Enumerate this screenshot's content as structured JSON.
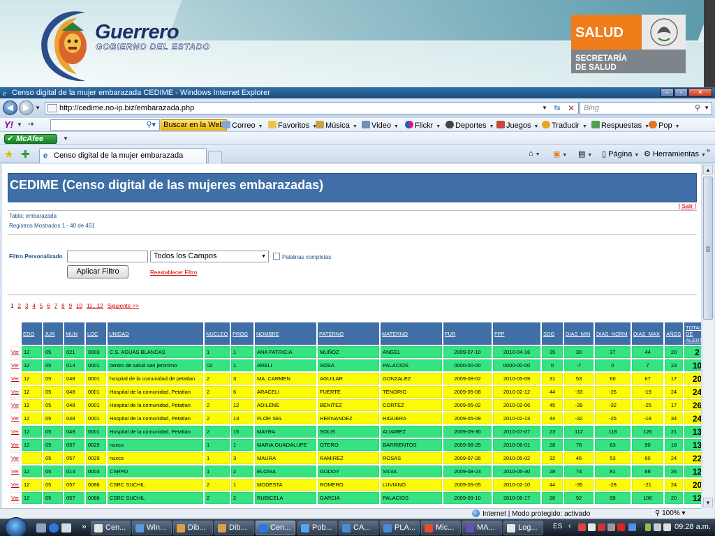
{
  "banner": {
    "brand": "Guerrero",
    "brand_sub": "GOBIERNO DEL ESTADO",
    "salud": "SALUD",
    "secretaria_line1": "SECRETARÍA",
    "secretaria_line2": "DE SALUD"
  },
  "window": {
    "title": "Censo digital de la mujer embarazada CEDIME - Windows Internet Explorer",
    "url": "http://cedime.no-ip.biz/embarazada.php",
    "search_placeholder": "Bing"
  },
  "yahoo_toolbar": {
    "search_button": "Buscar en la Web",
    "items": [
      "Correo",
      "Favoritos",
      "Música",
      "Video",
      "Flickr",
      "Deportes",
      "Juegos",
      "Traducir",
      "Respuestas",
      "Pop"
    ]
  },
  "mcafee": {
    "label": "McAfee"
  },
  "tab": {
    "label": "Censo digital de la mujer embarazada CEDIME"
  },
  "command_bar": {
    "pagina": "Página",
    "herramientas": "Herramientas"
  },
  "page": {
    "title": "CEDIME (Censo digital de las mujeres embarazadas)",
    "logout": "[ Salir ]",
    "tabla": "Tabla: embarazada",
    "registros": "Registros Mostrados 1 - 40 de 451",
    "filter_label": "Filtro Personalizado",
    "filter_value": "",
    "filter_select": "Todos los Campos",
    "words_label": "Palabras completas",
    "apply_button": "Aplicar Filtro",
    "reset_link": "Reestablecer Filtro"
  },
  "pager": [
    "1",
    "2",
    "3",
    "4",
    "5",
    "6",
    "7",
    "8",
    "9",
    "10",
    "11...12",
    "Siguiente >>"
  ],
  "table": {
    "headers": [
      "",
      "EDO",
      "JUR",
      "MUN",
      "LOC",
      "UNIDAD",
      "NUCLEO",
      "PROG",
      "NOMBRE",
      "PATERNO",
      "MATERNO",
      "FUR",
      "FPP",
      "SDG",
      "DIAS_MIN",
      "DIAS_NORM",
      "DIAS_MAX",
      "AÑOS",
      "TOTAL DE ALERTA"
    ],
    "link_label": "Ver",
    "rows": [
      {
        "color": "green",
        "cells": [
          "12",
          "05",
          "021",
          "0003",
          "C.S. AGUAS BLANCAS",
          "1",
          "1",
          "ANA PATRICIA",
          "MUÑOZ",
          "ANGEL",
          "2009-07-10",
          "2010-04-16",
          "35",
          "30",
          "37",
          "44",
          "20",
          "2"
        ]
      },
      {
        "color": "green",
        "cells": [
          "12",
          "05",
          "014",
          "0001",
          "centro de salud san jeronimo",
          "02",
          "1",
          "ARELI",
          "SOSA",
          "PALACIOS",
          "0000-00-00",
          "0000-00-00",
          "0",
          "-7",
          "0",
          "7",
          "23",
          "10"
        ]
      },
      {
        "color": "yellow",
        "cells": [
          "12",
          "05",
          "048",
          "0001",
          "hospital de la comunidad de petatlan",
          "2",
          "3",
          "MA. CARMEN",
          "AGUILAR",
          "GONZALEZ",
          "2009-08-02",
          "2010-05-09",
          "31",
          "53",
          "60",
          "67",
          "17",
          "20"
        ]
      },
      {
        "color": "yellow",
        "cells": [
          "12",
          "05",
          "048",
          "0001",
          "Hospital de la comunidad, Petatlan",
          "2",
          "6",
          "ARACELI",
          "FUERTE",
          "TENORIO",
          "2009-05-08",
          "2010-02-12",
          "44",
          "-33",
          "-26",
          "-19",
          "24",
          "24"
        ]
      },
      {
        "color": "yellow",
        "cells": [
          "12",
          "05",
          "048",
          "0001",
          "Hospital de la comunidad, Petatlan",
          "2",
          "12",
          "ADILENE",
          "BENITEZ",
          "CORTEZ",
          "2009-05-02",
          "2010-02-06",
          "45",
          "-39",
          "-32",
          "-25",
          "17",
          "26"
        ]
      },
      {
        "color": "yellow",
        "cells": [
          "12",
          "05",
          "048",
          "0001",
          "Hospital de la comunidad, Petatlan",
          "2",
          "13",
          "FLOR SEL",
          "HERNANDEZ",
          "HIGUERA",
          "2009-05-09",
          "2010-02-13",
          "44",
          "-32",
          "-25",
          "-18",
          "34",
          "24"
        ]
      },
      {
        "color": "green",
        "cells": [
          "12",
          "05",
          "048",
          "0001",
          "Hospital de la comunidad, Petatlan",
          "2",
          "15",
          "MAYRA",
          "SOLIS",
          "ALVAREZ",
          "2009-09-30",
          "2010-07-07",
          "23",
          "112",
          "118",
          "126",
          "21",
          "13"
        ]
      },
      {
        "color": "green",
        "cells": [
          "12",
          "05",
          "057",
          "0029",
          "nuxco",
          "1",
          "1",
          "MARIA GUADALUPE",
          "OTERO",
          "BARRIENTOS",
          "2009-08-25",
          "2010-06-01",
          "28",
          "76",
          "83",
          "90",
          "18",
          "13"
        ]
      },
      {
        "color": "yellow",
        "cells": [
          "",
          "05",
          "057",
          "0029",
          "nuxco",
          "1",
          "3",
          "MAURA",
          "RAMIREZ",
          "ROSAS",
          "2009-07-26",
          "2010-05-02",
          "32",
          "46",
          "53",
          "60",
          "24",
          "22"
        ]
      },
      {
        "color": "green",
        "cells": [
          "12",
          "05",
          "014",
          "0003",
          "CSRPD",
          "1",
          "2",
          "ELOISA",
          "GODOY",
          "SILVA",
          "2009-08-23",
          "2010-05-30",
          "28",
          "74",
          "81",
          "88",
          "26",
          "12"
        ]
      },
      {
        "color": "yellow",
        "cells": [
          "12",
          "05",
          "057",
          "0086",
          "CSRC SUCHIL",
          "2",
          "1",
          "MODESTA",
          "ROMERO",
          "LUVIANO",
          "2009-05-05",
          "2010-02-10",
          "44",
          "-35",
          "-28",
          "-21",
          "24",
          "20"
        ]
      },
      {
        "color": "green",
        "cells": [
          "12",
          "05",
          "057",
          "0086",
          "CSRC SUCHIL",
          "2",
          "2",
          "RUBICELA",
          "GARCIA",
          "PALACIOS",
          "2009-09-10",
          "2010-06-17",
          "26",
          "92",
          "99",
          "106",
          "20",
          "12"
        ]
      }
    ]
  },
  "status": {
    "zone": "Internet | Modo protegido: activado",
    "zoom": "100%"
  },
  "taskbar": {
    "tasks": [
      "Cen...",
      "Win...",
      "Dib...",
      "Dib...",
      "Cen...",
      "Pob...",
      "CA...",
      "PLA...",
      "Mic...",
      "MA...",
      "Log..."
    ],
    "lang": "ES",
    "clock": "09:28 a.m."
  },
  "colors": {
    "header_blue": "#3f6fa6",
    "row_green": "#35e380",
    "row_yellow": "#fbfb04",
    "link_red": "#cc0000"
  }
}
